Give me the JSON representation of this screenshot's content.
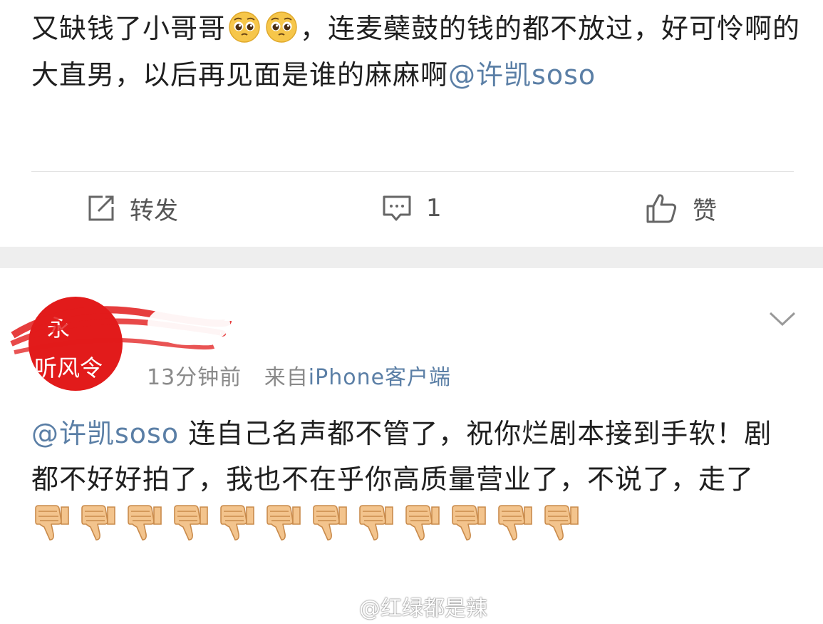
{
  "post1": {
    "text_a": "又缺钱了小哥哥",
    "text_b": "，连麦蘗鼓的钱的都不放过，好可怜啊的大直男，以后再见面是谁的麻麻啊",
    "mention": "@许凯soso",
    "emoji": "pleading-face-emoji",
    "actions": {
      "repost_label": "转发",
      "comment_count": "1",
      "like_label": "赞"
    }
  },
  "post2": {
    "avatar_text_line1": "永",
    "avatar_text_line2": "听风令",
    "time": "13分钟前",
    "source_prefix": "来自",
    "source": "iPhone客户端",
    "mention": "@许凯soso",
    "text": " 连自己名声都不管了，祝你烂剧本接到手软！剧都不好好拍了，我也不在乎你高质量营业了，不说了，走了",
    "thumbs_down_count": 12,
    "emoji": "thumbs-down-emoji"
  },
  "watermark": "@红绿都是辣",
  "colors": {
    "link": "#5b7fa6",
    "avatar_bg": "#e21b1b",
    "separator_band": "#eeeeee"
  }
}
